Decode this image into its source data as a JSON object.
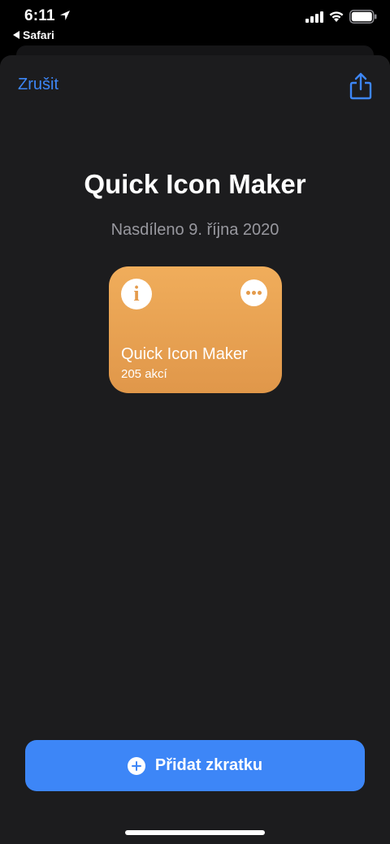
{
  "status_bar": {
    "time": "6:11",
    "back_app": "Safari",
    "icons": [
      "location-arrow-icon",
      "cellular-signal-icon",
      "wifi-icon",
      "battery-icon"
    ]
  },
  "header": {
    "cancel_label": "Zrušit",
    "share_icon": "share-icon"
  },
  "main": {
    "title": "Quick Icon Maker",
    "shared_date": "Nasdíleno 9. října 2020"
  },
  "shortcut_card": {
    "name": "Quick Icon Maker",
    "actions": "205 akcí",
    "info_icon_glyph": "i",
    "color": "#e8a253"
  },
  "footer": {
    "add_label": "Přidat zkratku",
    "button_color": "#3d86f7"
  }
}
